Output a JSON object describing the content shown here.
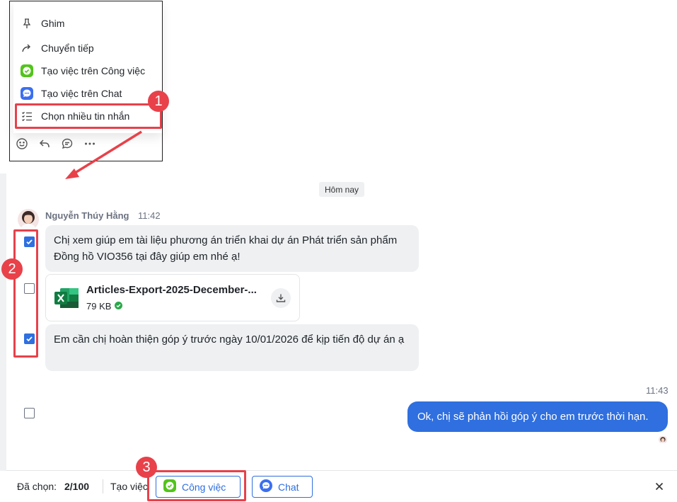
{
  "context_menu": {
    "items": [
      {
        "label": "Ghim",
        "icon": "pin-icon"
      },
      {
        "label": "Chuyển tiếp",
        "icon": "forward-icon"
      },
      {
        "label": "Tạo việc trên Công việc",
        "icon": "task-app-icon"
      },
      {
        "label": "Tạo việc trên Chat",
        "icon": "chat-app-icon"
      },
      {
        "label": "Chọn nhiều tin nhắn",
        "icon": "multi-select-icon"
      }
    ],
    "reactions": [
      "emoji-icon",
      "reply-icon",
      "comment-icon",
      "more-icon"
    ]
  },
  "annotations": {
    "step1": "1",
    "step2": "2",
    "step3": "3",
    "color": "#e8414a"
  },
  "chat": {
    "date_divider": "Hôm nay",
    "sender_name": "Nguyễn Thúy Hằng",
    "sender_time": "11:42",
    "messages": [
      {
        "text": "Chị xem giúp em tài liệu phương án triển khai dự án Phát triển sản phẩm Đồng hồ VIO356 tại đây giúp em nhé ạ!",
        "checked": true
      },
      {
        "file_name": "Articles-Export-2025-December-...",
        "file_size": "79 KB",
        "checked": false
      },
      {
        "text": "Em cần chị hoàn thiện góp ý trước ngày 10/01/2026 để kịp tiến độ dự án ạ",
        "checked": true
      }
    ],
    "outgoing": {
      "time": "11:43",
      "text": "Ok, chị sẽ phản hồi góp ý cho em trước thời hạn.",
      "checked": false
    }
  },
  "selection_bar": {
    "selected_label": "Đã chọn:",
    "selected_count": "2/100",
    "create_label": "Tạo việc",
    "task_button": "Công việc",
    "chat_button": "Chat"
  },
  "colors": {
    "accent": "#2f6fdf",
    "task_green": "#52c41a",
    "bubble_in": "#eef0f2"
  }
}
